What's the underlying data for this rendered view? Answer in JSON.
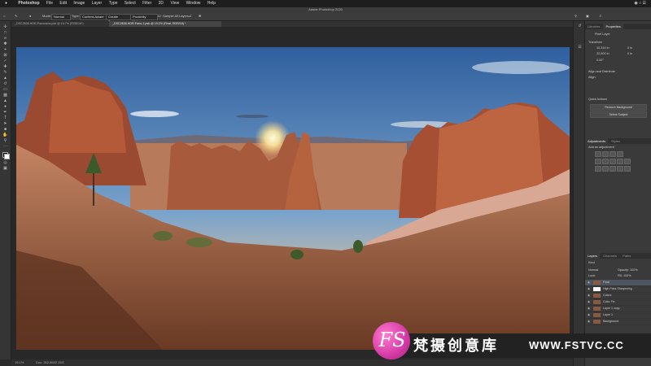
{
  "menubar": {
    "app": "Photoshop",
    "items": [
      "File",
      "Edit",
      "Image",
      "Layer",
      "Type",
      "Select",
      "Filter",
      "3D",
      "View",
      "Window",
      "Help"
    ]
  },
  "titlebar": {
    "title": "Adobe Photoshop 2020"
  },
  "options": {
    "mode_label": "Mode:",
    "mode_value": "Normal",
    "type_label": "Type:",
    "type_value": "Content-Aware",
    "create_texture": "Create Texture",
    "proximity": "Proximity Match",
    "sample_all": "Sample All Layers"
  },
  "tabs": [
    "_DSC2636-HDR-Panorama.psb @ 16.7% (RGB/16*)",
    "_DSC2636-HDR-Pano-1.psb @ 19.1% (Final, RGB/16) *"
  ],
  "status": {
    "zoom": "19.1%",
    "doc": "Doc: 262.6M/2.15G"
  },
  "properties": {
    "tabs": [
      "Libraries",
      "Properties"
    ],
    "layer_type": "Pixel Layer",
    "transform_label": "Transform",
    "w": "10,314 in",
    "h": "22,500 in",
    "x": "0 in",
    "y": "0 in",
    "angle": "0.00°",
    "align_label": "Align and Distribute",
    "align_sub": "Align:",
    "quick_actions": "Quick Actions",
    "remove_bg": "Remove Background",
    "select_subject": "Select Subject"
  },
  "adjustments": {
    "tabs": [
      "Adjustments",
      "Styles"
    ],
    "add_label": "Add an adjustment"
  },
  "layers": {
    "tabs": [
      "Layers",
      "Channels",
      "Paths"
    ],
    "kind": "Kind",
    "blend": "Normal",
    "opacity": "Opacity: 100%",
    "lock": "Lock:",
    "fill": "Fill: 100%",
    "items": [
      {
        "name": "Final",
        "selected": true,
        "mask": false
      },
      {
        "name": "High Pass Sharpening",
        "selected": false,
        "mask": true
      },
      {
        "name": "Colors",
        "selected": false,
        "mask": false
      },
      {
        "name": "Color Fix",
        "selected": false,
        "mask": false
      },
      {
        "name": "Layer 1 copy",
        "selected": false,
        "mask": false
      },
      {
        "name": "Layer 1",
        "selected": false,
        "mask": false
      },
      {
        "name": "Background",
        "selected": false,
        "mask": false
      }
    ]
  },
  "watermark": {
    "logo": "FS",
    "cn": "梵摄创意库",
    "url": "WWW.FSTVC.CC"
  }
}
